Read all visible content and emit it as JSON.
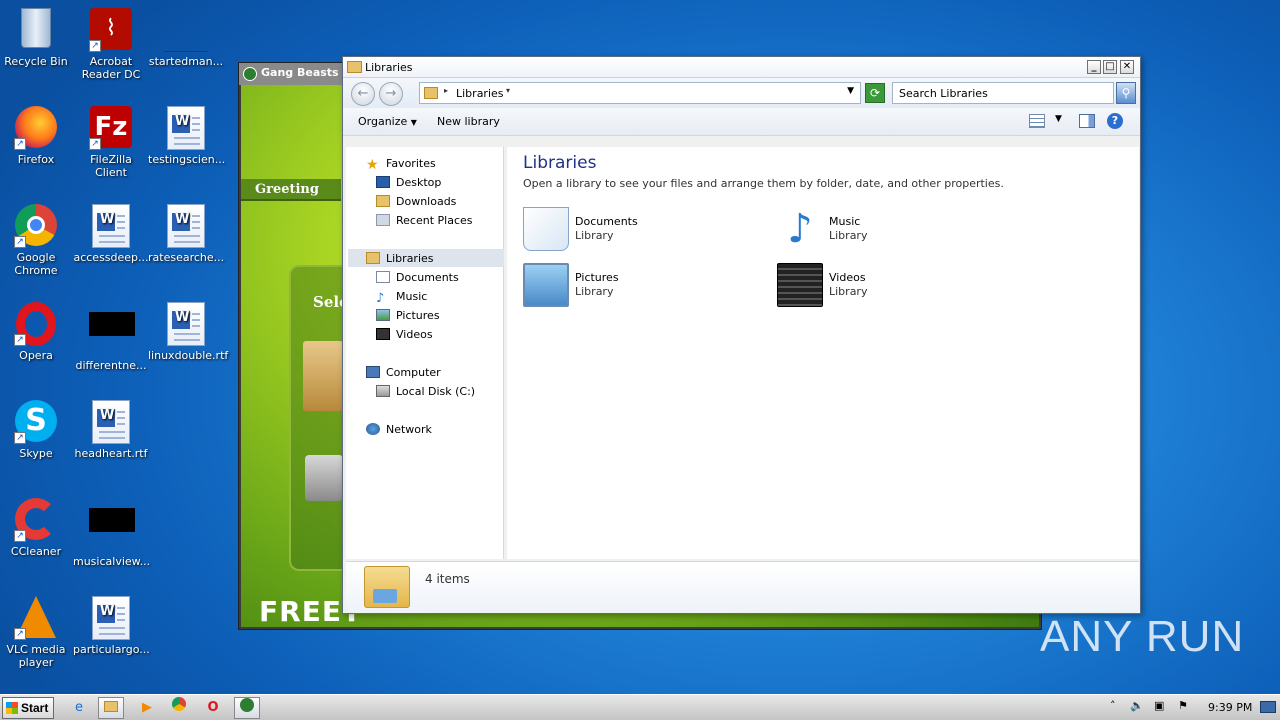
{
  "desktop_icons": [
    {
      "label": "Recycle Bin",
      "icon": "recycle-bin-icon"
    },
    {
      "label": "Acrobat Reader DC",
      "icon": "acrobat-icon"
    },
    {
      "label": "startedman...",
      "icon": "blank-file-icon"
    },
    {
      "label": "Firefox",
      "icon": "firefox-icon"
    },
    {
      "label": "FileZilla Client",
      "icon": "filezilla-icon"
    },
    {
      "label": "testingscien...",
      "icon": "word-doc-icon"
    },
    {
      "label": "Google Chrome",
      "icon": "chrome-icon"
    },
    {
      "label": "accessdeep...",
      "icon": "word-doc-icon"
    },
    {
      "label": "ratesearche...",
      "icon": "word-doc-icon"
    },
    {
      "label": "Opera",
      "icon": "opera-icon"
    },
    {
      "label": "differentne...",
      "icon": "black-file-icon"
    },
    {
      "label": "linuxdouble.rtf",
      "icon": "word-doc-icon"
    },
    {
      "label": "Skype",
      "icon": "skype-icon"
    },
    {
      "label": "headheart.rtf",
      "icon": "word-doc-icon"
    },
    {
      "label": "CCleaner",
      "icon": "ccleaner-icon"
    },
    {
      "label": "musicalview...",
      "icon": "black-file-icon"
    },
    {
      "label": "VLC media player",
      "icon": "vlc-icon"
    },
    {
      "label": "particulargo...",
      "icon": "word-doc-icon"
    }
  ],
  "gang_beasts": {
    "title": "Gang Beasts",
    "greeting": "Greeting",
    "select": "Sele",
    "free": "FREET"
  },
  "explorer": {
    "title": "Libraries",
    "address": "Libraries",
    "search_placeholder": "Search Libraries",
    "toolbar": {
      "organize": "Organize",
      "new_library": "New library"
    },
    "nav": {
      "favorites": "Favorites",
      "desktop": "Desktop",
      "downloads": "Downloads",
      "recent": "Recent Places",
      "libraries": "Libraries",
      "documents": "Documents",
      "music": "Music",
      "pictures": "Pictures",
      "videos": "Videos",
      "computer": "Computer",
      "local_disk": "Local Disk (C:)",
      "network": "Network"
    },
    "content": {
      "heading": "Libraries",
      "subtitle": "Open a library to see your files and arrange them by folder, date, and other properties.",
      "items": [
        {
          "name": "Documents",
          "type": "Library"
        },
        {
          "name": "Music",
          "type": "Library"
        },
        {
          "name": "Pictures",
          "type": "Library"
        },
        {
          "name": "Videos",
          "type": "Library"
        }
      ]
    },
    "status": "4 items"
  },
  "taskbar": {
    "start": "Start",
    "clock": "9:39 PM"
  },
  "watermark": "ANY RUN"
}
